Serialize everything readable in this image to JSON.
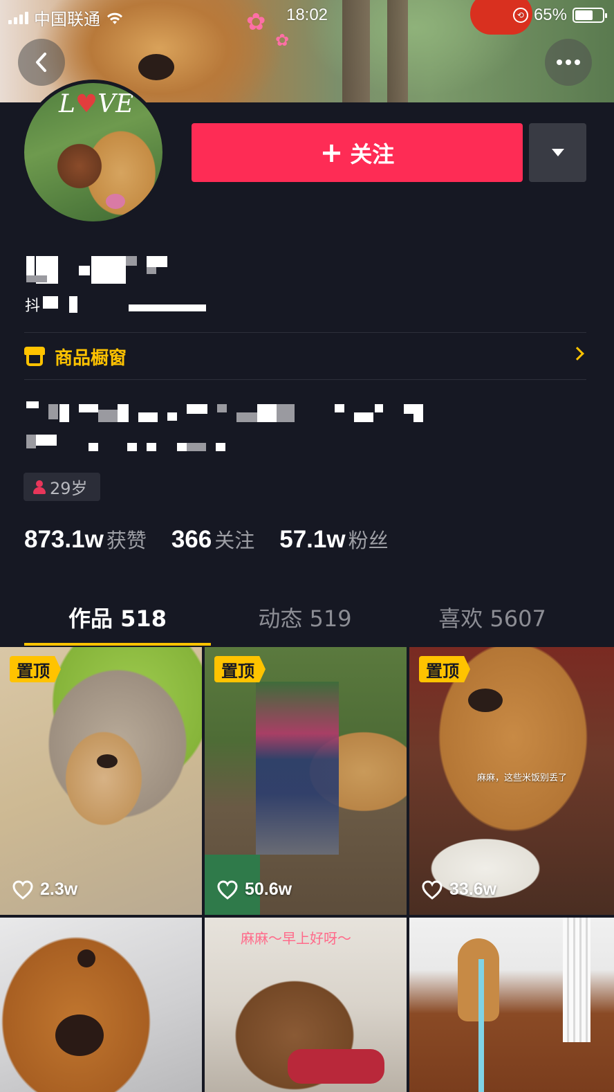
{
  "status_bar": {
    "carrier": "中国联通",
    "time": "18:02",
    "battery_percent": "65%",
    "battery_level": 0.65
  },
  "cover": {
    "icon_back": "chevron-left-icon",
    "icon_more": "more-dots-icon"
  },
  "avatar": {
    "text": "LOVE"
  },
  "actions": {
    "follow_label": "关注",
    "follow_plus": "+",
    "follow_color": "#fe2c55"
  },
  "profile": {
    "id_prefix": "抖"
  },
  "shop": {
    "label": "商品橱窗",
    "accent": "#ffc300"
  },
  "age_tag": {
    "label": "29岁"
  },
  "stats": [
    {
      "num": "873.1w",
      "label": "获赞"
    },
    {
      "num": "366",
      "label": "关注"
    },
    {
      "num": "57.1w",
      "label": "粉丝"
    }
  ],
  "tabs": [
    {
      "label": "作品 518",
      "active": true
    },
    {
      "label": "动态 519",
      "active": false
    },
    {
      "label": "喜欢 5607",
      "active": false
    }
  ],
  "videos": [
    {
      "pinned": "置顶",
      "likes": "2.3w"
    },
    {
      "pinned": "置顶",
      "likes": "50.6w"
    },
    {
      "pinned": "置顶",
      "likes": "33.6w",
      "caption": "麻麻，这些米饭别丢了"
    },
    {
      "likes": ""
    },
    {
      "likes": "",
      "caption": "麻麻～早上好呀～"
    },
    {
      "likes": ""
    }
  ]
}
